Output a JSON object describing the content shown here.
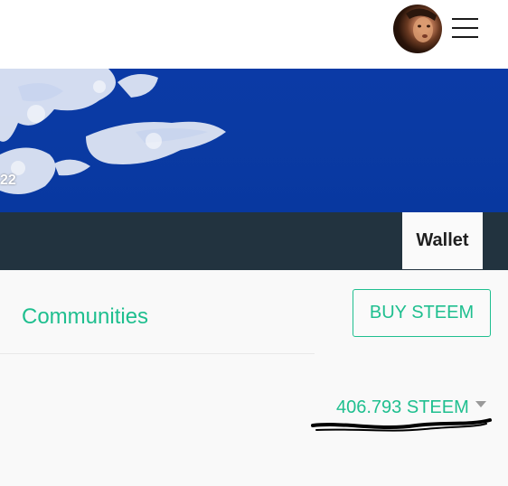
{
  "header": {
    "avatar_icon": "user-avatar",
    "menu_icon": "hamburger-menu-icon"
  },
  "cover": {
    "partial_text": "22"
  },
  "nav": {
    "active_tab": "Wallet"
  },
  "wallet": {
    "communities_label": "Communities",
    "buy_button_label": "BUY STEEM",
    "balance": "406.793 STEEM",
    "dropdown_icon": "caret-down-icon"
  },
  "colors": {
    "accent": "#1fbf8f",
    "navbar": "#22333f",
    "cover_blue": "#0a3aa3"
  }
}
